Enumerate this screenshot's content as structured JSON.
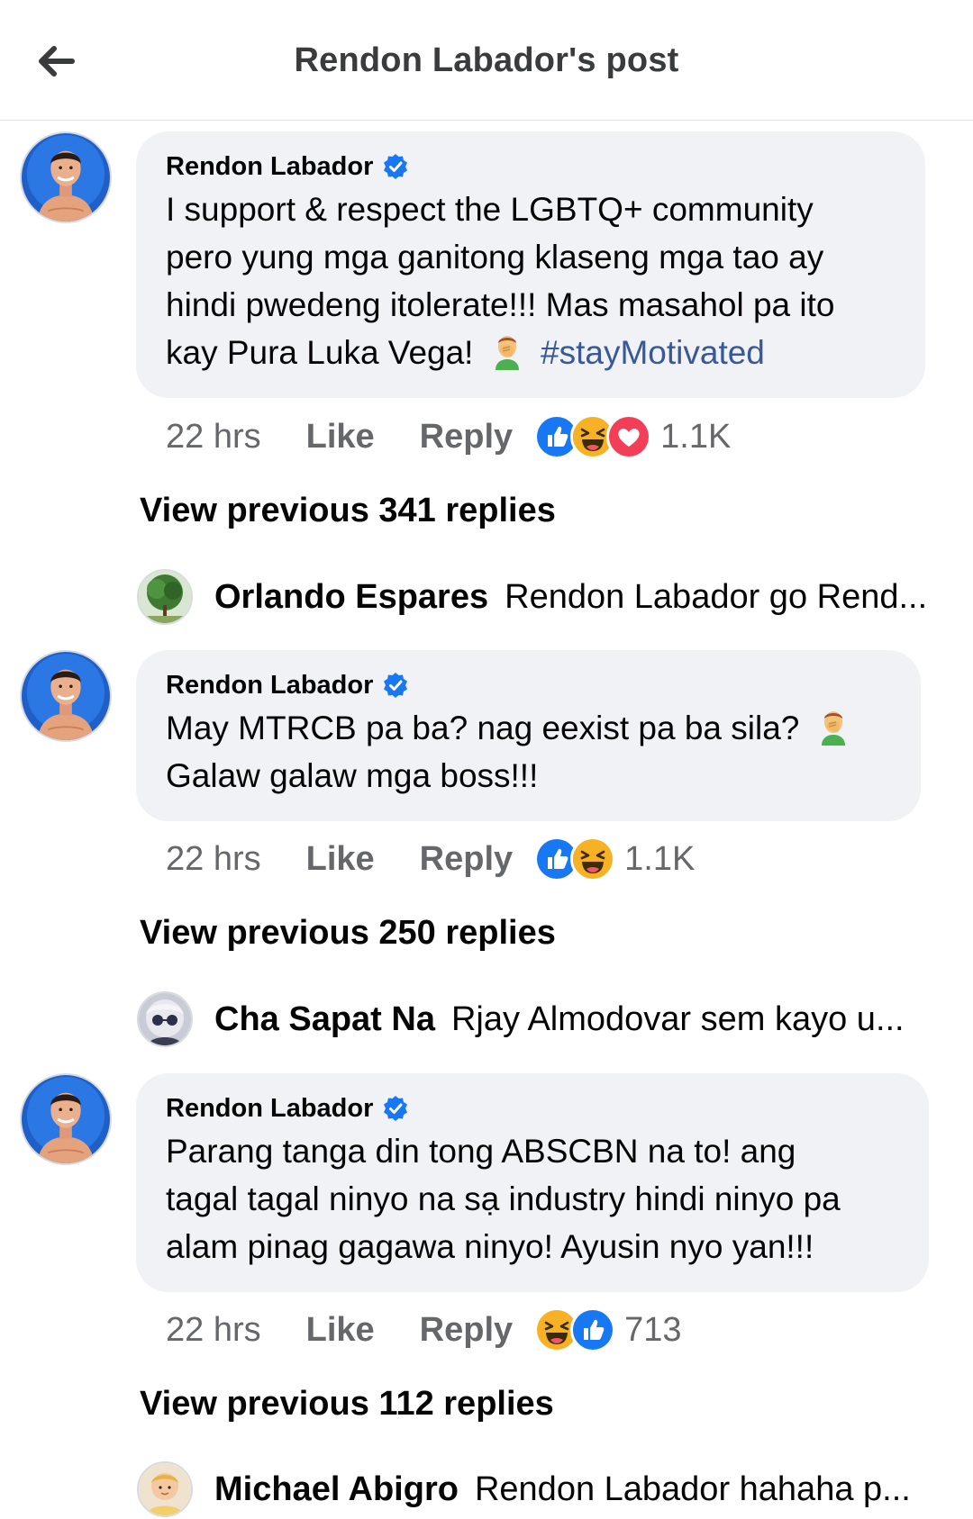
{
  "header": {
    "title": "Rendon Labador's post",
    "back_icon": "back-arrow-icon"
  },
  "colors": {
    "like_blue": "#1877f2",
    "love_red": "#f33e58",
    "haha_yellow": "#f7b125",
    "bubble_bg": "#f0f2f5",
    "meta_gray": "#65676b",
    "hashtag": "#385898"
  },
  "actions": {
    "like_label": "Like",
    "reply_label": "Reply"
  },
  "comments": [
    {
      "author": "Rendon Labador",
      "verified": true,
      "text_lines": [
        "I support & respect the LGBTQ+ community",
        "pero yung mga ganitong klaseng mga tao ay",
        "hindi pwedeng itolerate!!! Mas masahol pa ito",
        "kay Pura Luka Vega!"
      ],
      "emoji": "facepalm-emoji",
      "hashtag": "#stayMotivated",
      "time": "22 hrs",
      "reactions": [
        "like",
        "haha",
        "love"
      ],
      "reaction_count": "1.1K",
      "view_previous": "View previous 341 replies",
      "reply": {
        "name": "Orlando Espares",
        "text": "Rendon Labador go Rend..."
      }
    },
    {
      "author": "Rendon Labador",
      "verified": true,
      "text_lines": [
        "May MTRCB pa ba? nag eexist pa ba sila?",
        "Galaw galaw mga boss!!!"
      ],
      "emoji": "facepalm-emoji",
      "time": "22 hrs",
      "reactions": [
        "like",
        "haha"
      ],
      "reaction_count": "1.1K",
      "view_previous": "View previous 250 replies",
      "reply": {
        "name": "Cha Sapat Na",
        "text": "Rjay Almodovar sem kayo u..."
      }
    },
    {
      "author": "Rendon Labador",
      "verified": true,
      "text_lines": [
        "Parang tanga din tong ABSCBN na to! ang",
        "tagal tagal ninyo na sạ industry hindi ninyo pa",
        "alam pinag gagawa ninyo! Ayusin nyo yan!!!"
      ],
      "time": "22 hrs",
      "reactions": [
        "haha",
        "like"
      ],
      "reaction_count": "713",
      "view_previous": "View previous 112 replies",
      "reply": {
        "name": "Michael Abigro",
        "text": "Rendon Labador hahaha p..."
      }
    }
  ]
}
